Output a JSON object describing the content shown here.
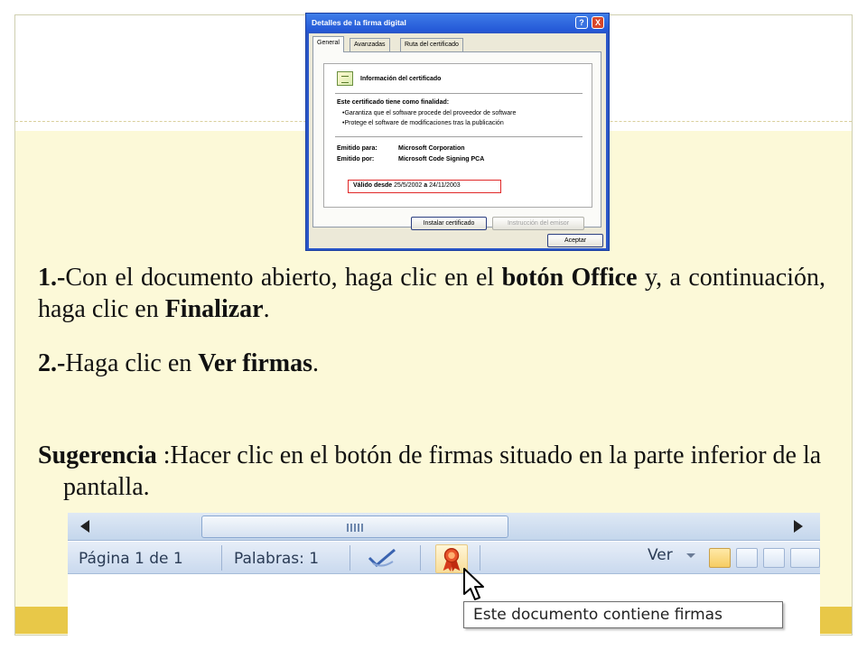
{
  "dialog": {
    "title": "Detalles de la firma digital",
    "help_btn": "?",
    "close_btn": "X",
    "tabs": [
      "General",
      "Avanzadas",
      "Ruta del certificado"
    ],
    "info_heading": "Información del certificado",
    "purpose_heading": "Este certificado tiene como finalidad:",
    "purposes": [
      "•Garantiza que el software procede del proveedor de software",
      "•Protege el software de modificaciones tras la publicación"
    ],
    "issued_to_label": "Emitido para:",
    "issued_to_value": "Microsoft Corporation",
    "issued_by_label": "Emitido por:",
    "issued_by_value": "Microsoft Code Signing PCA",
    "valid_from_label": "Válido desde",
    "valid_from": "25/5/2002",
    "valid_to_sep": "a",
    "valid_to": "24/11/2003",
    "install_btn": "Instalar certificado",
    "issuer_statement_btn": "Instrucción del emisor",
    "ok_btn": "Aceptar"
  },
  "instructions": {
    "step1_num": "1.-",
    "step1_a": "Con el documento abierto, haga clic en el ",
    "step1_b": "botón Office",
    "step1_c": " y, a continuación, haga clic en ",
    "step1_d": "Finalizar",
    "step1_e": ".",
    "step2_num": "2.-",
    "step2_a": "Haga clic en ",
    "step2_b": "Ver firmas",
    "step2_c": ".",
    "tip_label": "Sugerencia",
    "tip_text": " :Hacer clic en el botón de firmas situado en la parte inferior de la pantalla."
  },
  "statusbar": {
    "page": "Página 1 de 1",
    "words": "Palabras: 1",
    "view_label": "Ver",
    "tooltip": "Este documento contiene firmas"
  }
}
